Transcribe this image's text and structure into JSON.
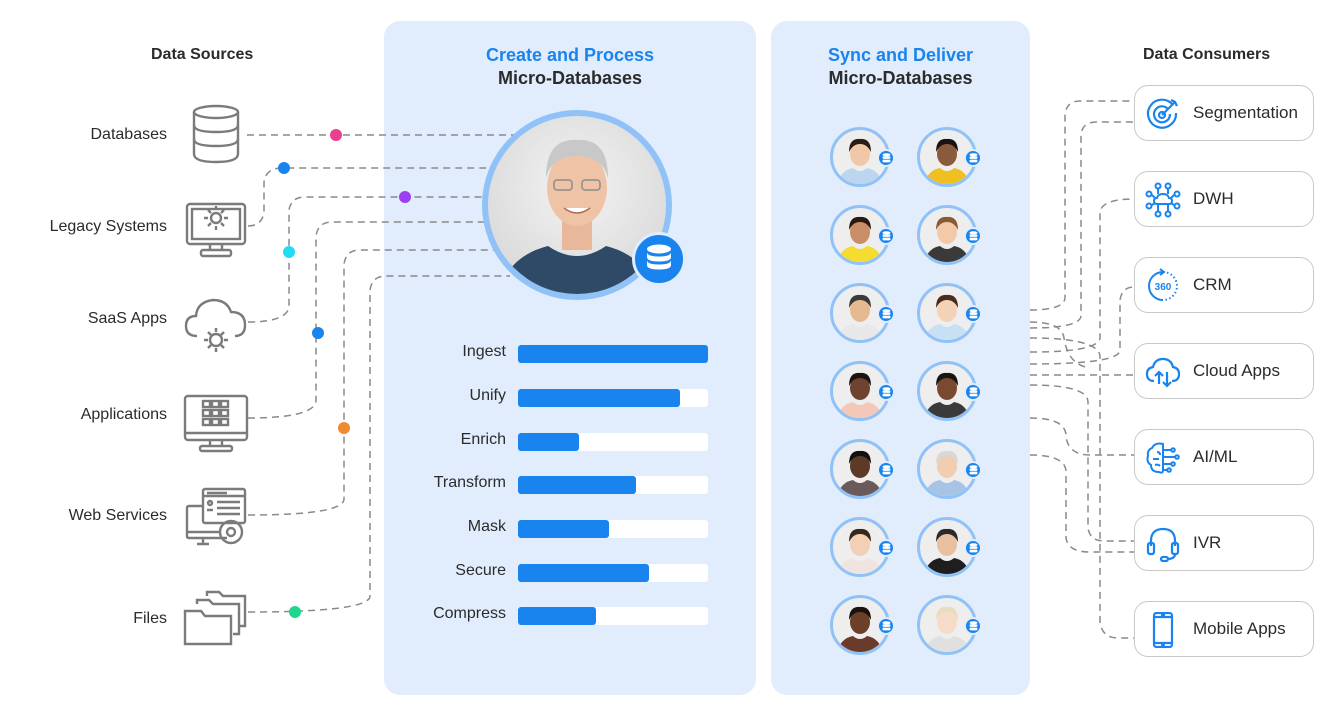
{
  "sources": {
    "title": "Data Sources",
    "items": [
      {
        "label": "Databases",
        "icon": "database-icon",
        "dot_color": "#ec3f8c"
      },
      {
        "label": "Legacy Systems",
        "icon": "monitor-gear-icon",
        "dot_color": "#1a84ee"
      },
      {
        "label": "SaaS Apps",
        "icon": "cloud-gear-icon",
        "dot_color": "#22dcf4"
      },
      {
        "label": "Applications",
        "icon": "monitor-apps-icon",
        "dot_color": "#1a84ee"
      },
      {
        "label": "Web Services",
        "icon": "web-service-icon",
        "dot_color": "#f08a2e"
      },
      {
        "label": "Files",
        "icon": "folders-icon",
        "dot_color": "#1ed68e"
      }
    ],
    "extra_dot_color": "#9a3ff0"
  },
  "process": {
    "title_accent": "Create and Process",
    "title_sub": "Micro-Databases",
    "steps": [
      {
        "label": "Ingest",
        "progress": 1.0
      },
      {
        "label": "Unify",
        "progress": 0.85
      },
      {
        "label": "Enrich",
        "progress": 0.32
      },
      {
        "label": "Transform",
        "progress": 0.62
      },
      {
        "label": "Mask",
        "progress": 0.48
      },
      {
        "label": "Secure",
        "progress": 0.69
      },
      {
        "label": "Compress",
        "progress": 0.41
      }
    ]
  },
  "sync": {
    "title_accent": "Sync and Deliver",
    "title_sub": "Micro-Databases",
    "avatar_count": 14
  },
  "consumers": {
    "title": "Data Consumers",
    "items": [
      {
        "label": "Segmentation",
        "icon": "target-icon"
      },
      {
        "label": "DWH",
        "icon": "network-cloud-icon"
      },
      {
        "label": "CRM",
        "icon": "360-icon"
      },
      {
        "label": "Cloud Apps",
        "icon": "cloud-sync-icon"
      },
      {
        "label": "AI/ML",
        "icon": "brain-icon"
      },
      {
        "label": "IVR",
        "icon": "headset-icon"
      },
      {
        "label": "Mobile Apps",
        "icon": "mobile-icon"
      }
    ]
  },
  "colors": {
    "accent": "#1a84ee",
    "panel": "#e1edfd",
    "ring": "#90c2f7",
    "wire": "#8a8a8a"
  }
}
